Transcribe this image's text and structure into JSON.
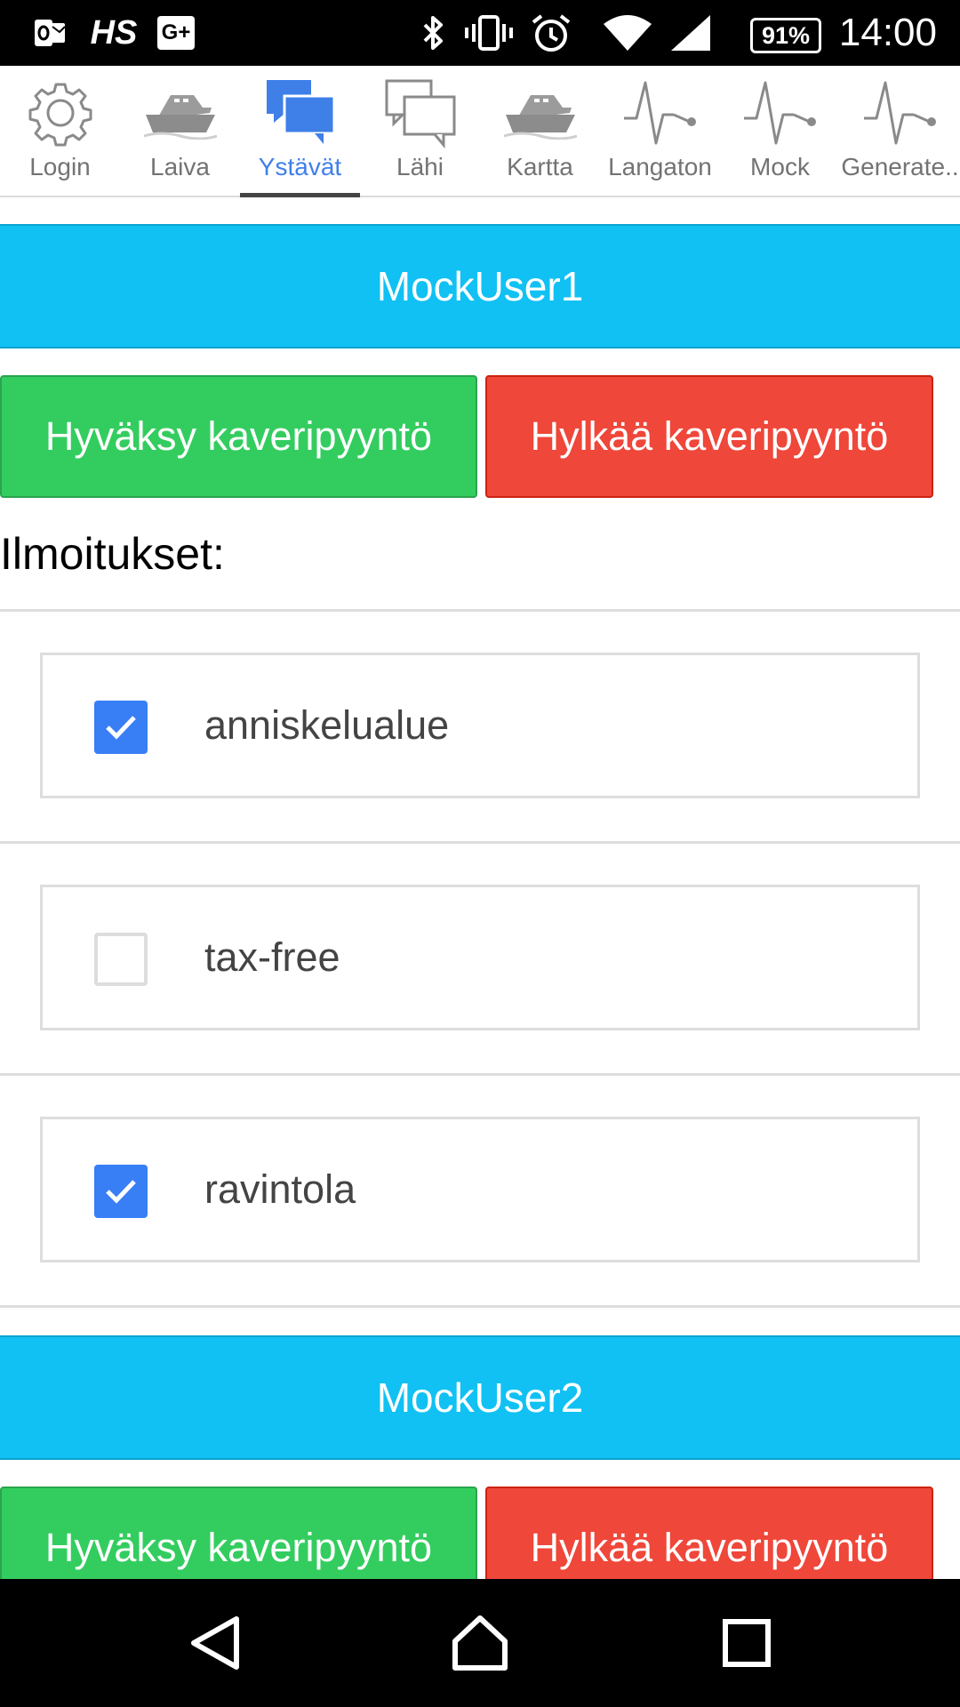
{
  "status_bar": {
    "notification_icons": [
      "outlook-icon",
      "hs-icon",
      "google-plus-icon"
    ],
    "hs_text": "HS",
    "gplus_text": "G+",
    "battery": "91%",
    "time": "14:00"
  },
  "tabs": [
    {
      "label": "Login",
      "icon": "gear-icon"
    },
    {
      "label": "Laiva",
      "icon": "ship-icon"
    },
    {
      "label": "Ystävät",
      "icon": "chat-bubbles-icon",
      "active": true
    },
    {
      "label": "Lähi",
      "icon": "chat-outline-icon"
    },
    {
      "label": "Kartta",
      "icon": "ship-icon"
    },
    {
      "label": "Langaton",
      "icon": "pulse-icon"
    },
    {
      "label": "Mock",
      "icon": "pulse-icon"
    },
    {
      "label": "Generate..",
      "icon": "pulse-icon"
    }
  ],
  "users": [
    {
      "name": "MockUser1",
      "accept_label": "Hyväksy kaveripyyntö",
      "reject_label": "Hylkää kaveripyyntö",
      "notifications_label": "Ilmoitukset:",
      "notifications": [
        {
          "label": "anniskelualue",
          "checked": true
        },
        {
          "label": "tax-free",
          "checked": false
        },
        {
          "label": "ravintola",
          "checked": true
        }
      ]
    },
    {
      "name": "MockUser2",
      "accept_label": "Hyväksy kaveripyyntö",
      "reject_label": "Hylkää kaveripyyntö"
    }
  ],
  "colors": {
    "header": "#11c1f3",
    "accept": "#33cd5f",
    "reject": "#ef473a",
    "checkbox": "#387ef5",
    "active_tab": "#3f7fe8"
  }
}
